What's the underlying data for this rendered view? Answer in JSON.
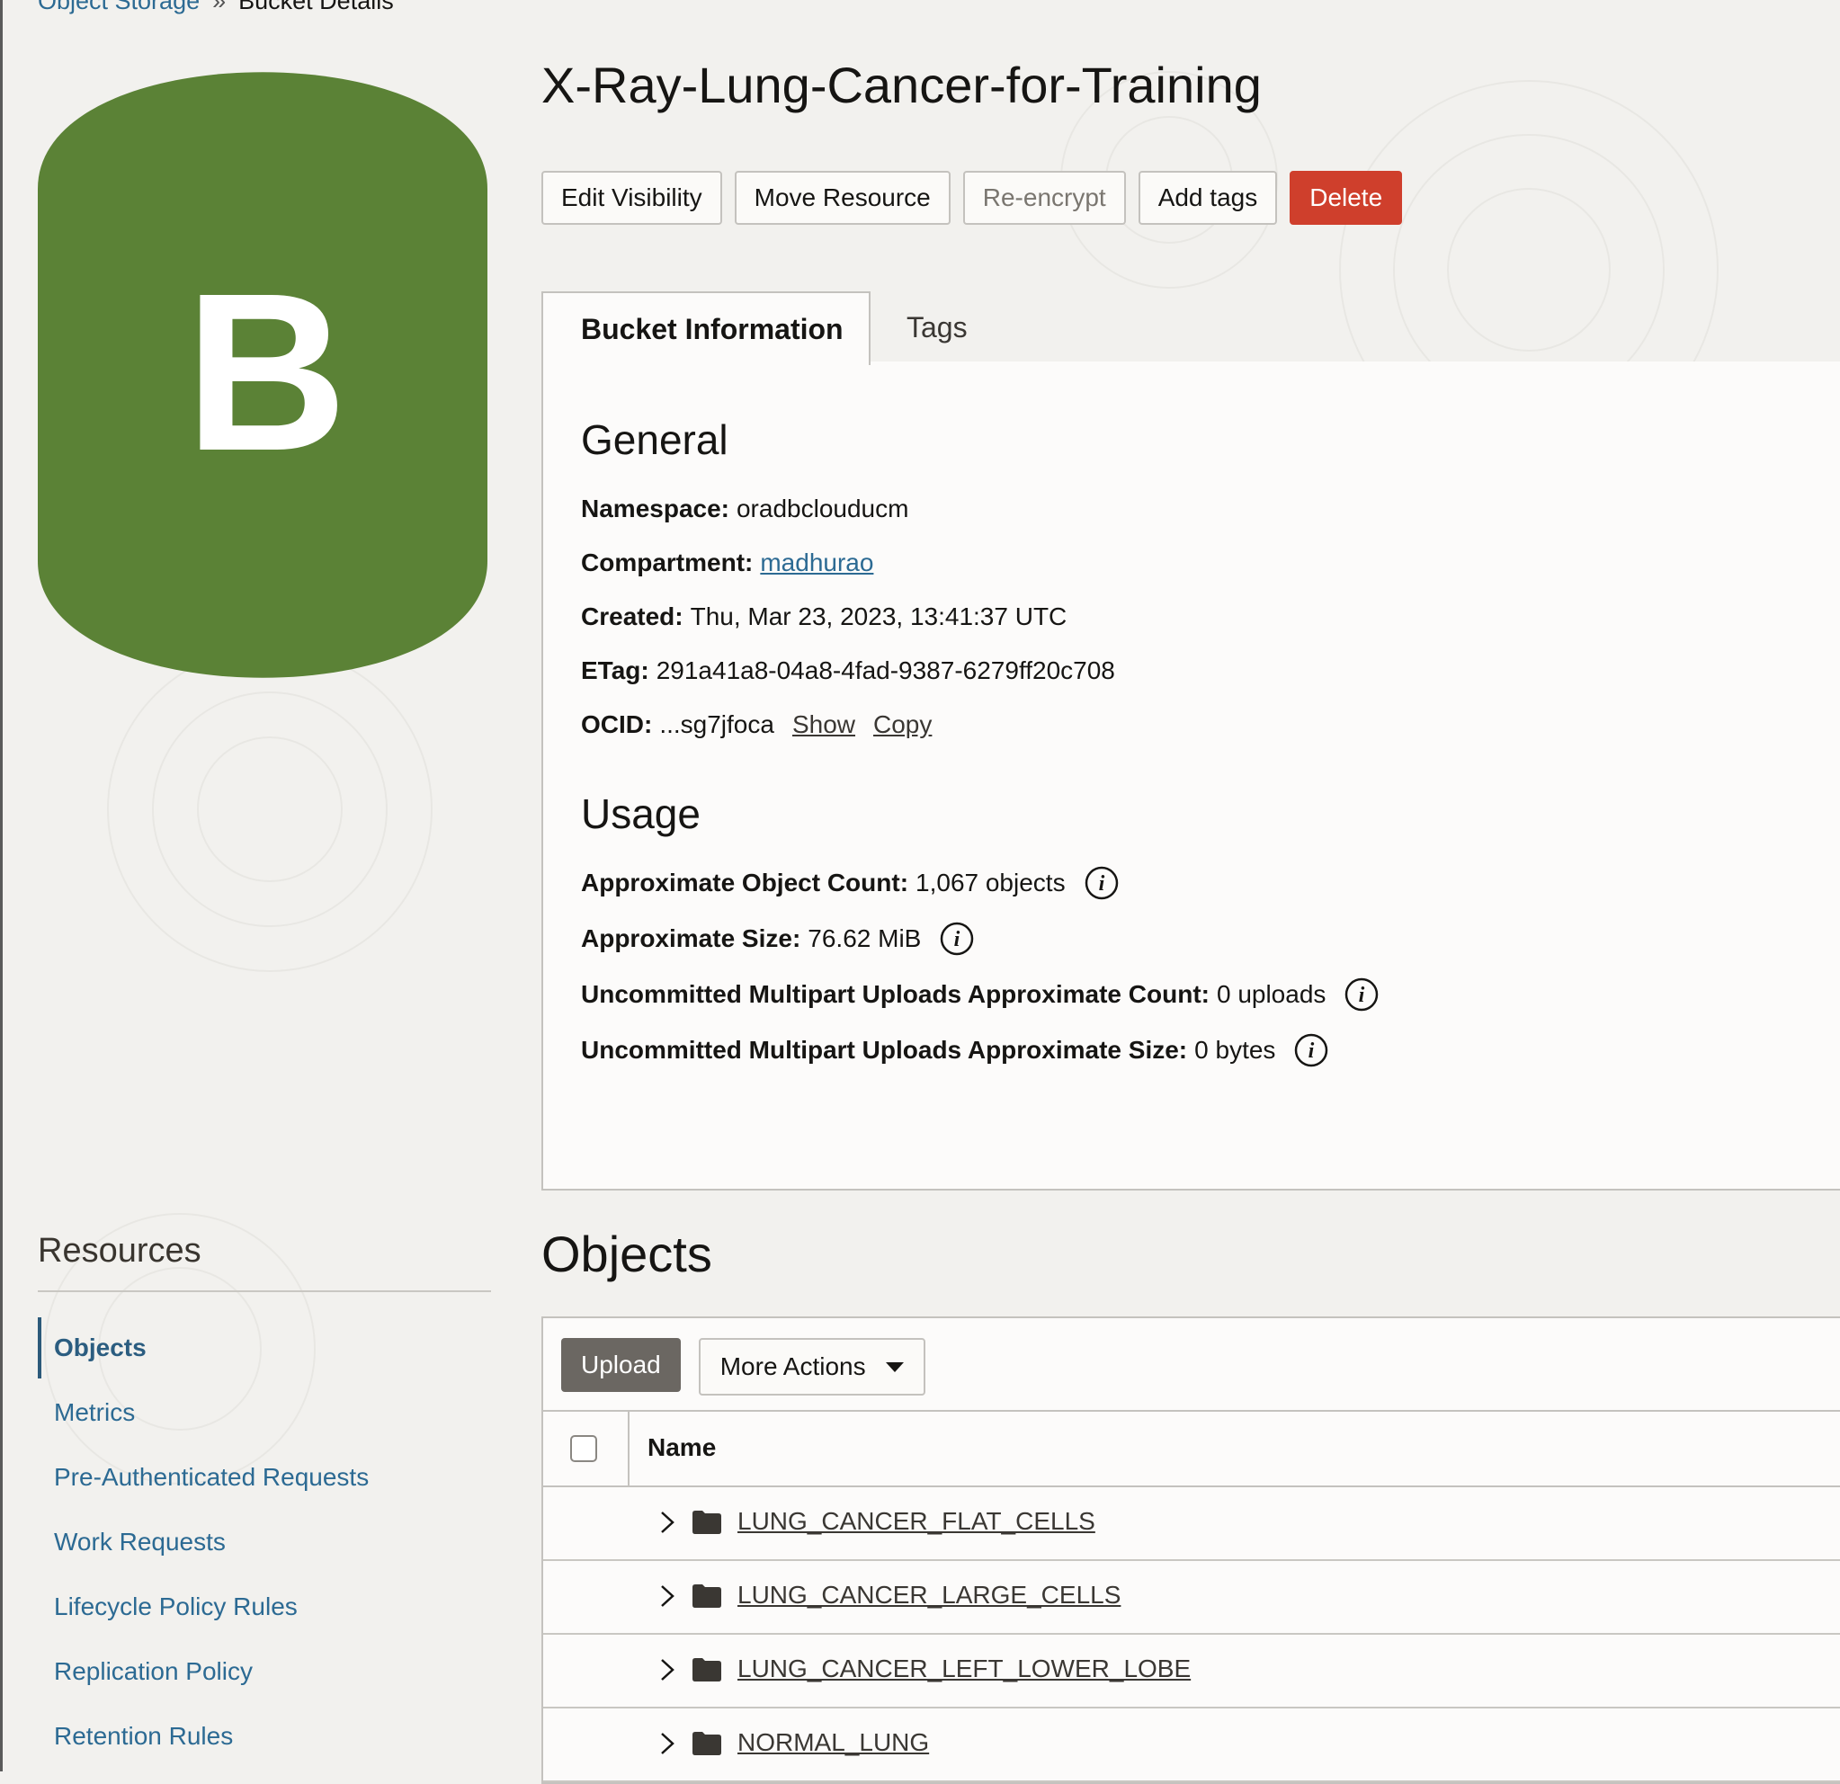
{
  "breadcrumb": {
    "parent": "Object Storage",
    "separator": "»",
    "current": "Bucket Details"
  },
  "bucket_icon": {
    "letter": "B",
    "color": "#5b8236"
  },
  "title": "X-Ray-Lung-Cancer-for-Training",
  "actions": {
    "edit_visibility": "Edit Visibility",
    "move_resource": "Move Resource",
    "reencrypt": "Re-encrypt",
    "add_tags": "Add tags",
    "delete": "Delete"
  },
  "tabs": {
    "bucket_info": "Bucket Information",
    "tags": "Tags"
  },
  "general": {
    "heading": "General",
    "namespace_label": "Namespace:",
    "namespace_value": "oradbclouducm",
    "compartment_label": "Compartment:",
    "compartment_value": "madhurao",
    "created_label": "Created:",
    "created_value": "Thu, Mar 23, 2023, 13:41:37 UTC",
    "etag_label": "ETag:",
    "etag_value": "291a41a8-04a8-4fad-9387-6279ff20c708",
    "ocid_label": "OCID:",
    "ocid_value": "...sg7jfoca",
    "ocid_show": "Show",
    "ocid_copy": "Copy"
  },
  "usage": {
    "heading": "Usage",
    "count_label": "Approximate Object Count:",
    "count_value": "1,067 objects",
    "size_label": "Approximate Size:",
    "size_value": "76.62 MiB",
    "mp_count_label": "Uncommitted Multipart Uploads Approximate Count:",
    "mp_count_value": "0 uploads",
    "mp_size_label": "Uncommitted Multipart Uploads Approximate Size:",
    "mp_size_value": "0 bytes"
  },
  "resources": {
    "title": "Resources",
    "items": [
      "Objects",
      "Metrics",
      "Pre-Authenticated Requests",
      "Work Requests",
      "Lifecycle Policy Rules",
      "Replication Policy",
      "Retention Rules"
    ]
  },
  "objects": {
    "title": "Objects",
    "upload": "Upload",
    "more_actions": "More Actions",
    "column_name": "Name",
    "rows": [
      "LUNG_CANCER_FLAT_CELLS",
      "LUNG_CANCER_LARGE_CELLS",
      "LUNG_CANCER_LEFT_LOWER_LOBE",
      "NORMAL_LUNG"
    ]
  },
  "colors": {
    "accent_link": "#2c6a93",
    "danger": "#cf3f2c",
    "bucket_green": "#5b8236"
  }
}
